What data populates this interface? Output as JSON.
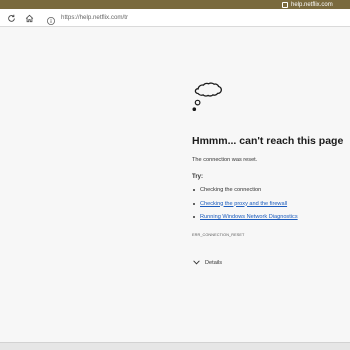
{
  "browser": {
    "tab_title": "help.netflix.com",
    "url": "https://help.netflix.com/tr"
  },
  "error_page": {
    "title": "Hmmm... can't reach this page",
    "subtitle": "The connection was reset.",
    "try_label": "Try:",
    "suggestions": [
      "Checking the connection",
      "Checking the proxy and the firewall",
      "Running Windows Network Diagnostics"
    ],
    "error_code": "ERR_CONNECTION_RESET",
    "details_label": "Details"
  },
  "icons": [
    "refresh-icon",
    "home-icon",
    "info-icon",
    "page-icon",
    "thought-cloud-icon",
    "chevron-down-icon"
  ],
  "colors": {
    "tab_bar": "#7a6a3e",
    "link": "#1a5bbd",
    "background": "#f7f7f7"
  }
}
